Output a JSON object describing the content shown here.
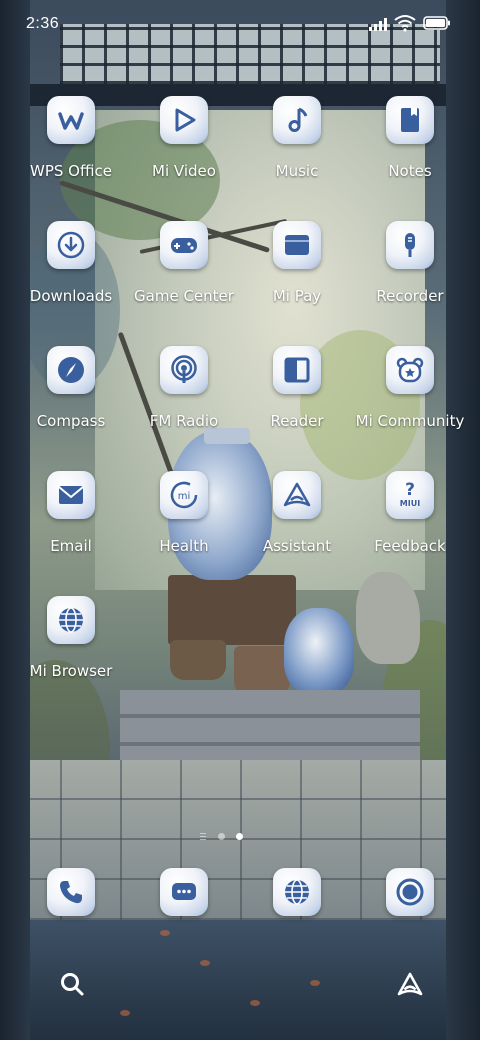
{
  "status_bar": {
    "time": "2:36"
  },
  "apps": [
    {
      "id": "wps-office",
      "label": "WPS Office",
      "icon": "wps-office-icon"
    },
    {
      "id": "mi-video",
      "label": "Mi Video",
      "icon": "play-icon"
    },
    {
      "id": "music",
      "label": "Music",
      "icon": "music-note-icon"
    },
    {
      "id": "notes",
      "label": "Notes",
      "icon": "notes-icon"
    },
    {
      "id": "downloads",
      "label": "Downloads",
      "icon": "download-icon"
    },
    {
      "id": "game-center",
      "label": "Game Center",
      "icon": "gamepad-icon"
    },
    {
      "id": "mi-pay",
      "label": "Mi Pay",
      "icon": "wallet-icon"
    },
    {
      "id": "recorder",
      "label": "Recorder",
      "icon": "microphone-icon"
    },
    {
      "id": "compass",
      "label": "Compass",
      "icon": "compass-icon"
    },
    {
      "id": "fm-radio",
      "label": "FM Radio",
      "icon": "radio-icon"
    },
    {
      "id": "reader",
      "label": "Reader",
      "icon": "book-icon"
    },
    {
      "id": "mi-community",
      "label": "Mi Community",
      "icon": "bear-icon"
    },
    {
      "id": "email",
      "label": "Email",
      "icon": "envelope-icon"
    },
    {
      "id": "health",
      "label": "Health",
      "icon": "mi-health-icon",
      "icon_text": "mi"
    },
    {
      "id": "assistant",
      "label": "Assistant",
      "icon": "assistant-icon"
    },
    {
      "id": "feedback",
      "label": "Feedback",
      "icon": "feedback-icon",
      "icon_text": "MIUI"
    },
    {
      "id": "mi-browser",
      "label": "Mi Browser",
      "icon": "globe-icon"
    }
  ],
  "page_indicator": {
    "pages": 2,
    "current": 2
  },
  "dock": [
    {
      "id": "phone",
      "icon": "phone-icon"
    },
    {
      "id": "messages",
      "icon": "message-icon"
    },
    {
      "id": "browser",
      "icon": "globe-icon"
    },
    {
      "id": "camera",
      "icon": "camera-icon"
    }
  ],
  "bottom": {
    "left": "search-icon",
    "right": "assistant-icon"
  },
  "colors": {
    "icon_blue": "#3a5f9e",
    "label": "#ffffff"
  }
}
